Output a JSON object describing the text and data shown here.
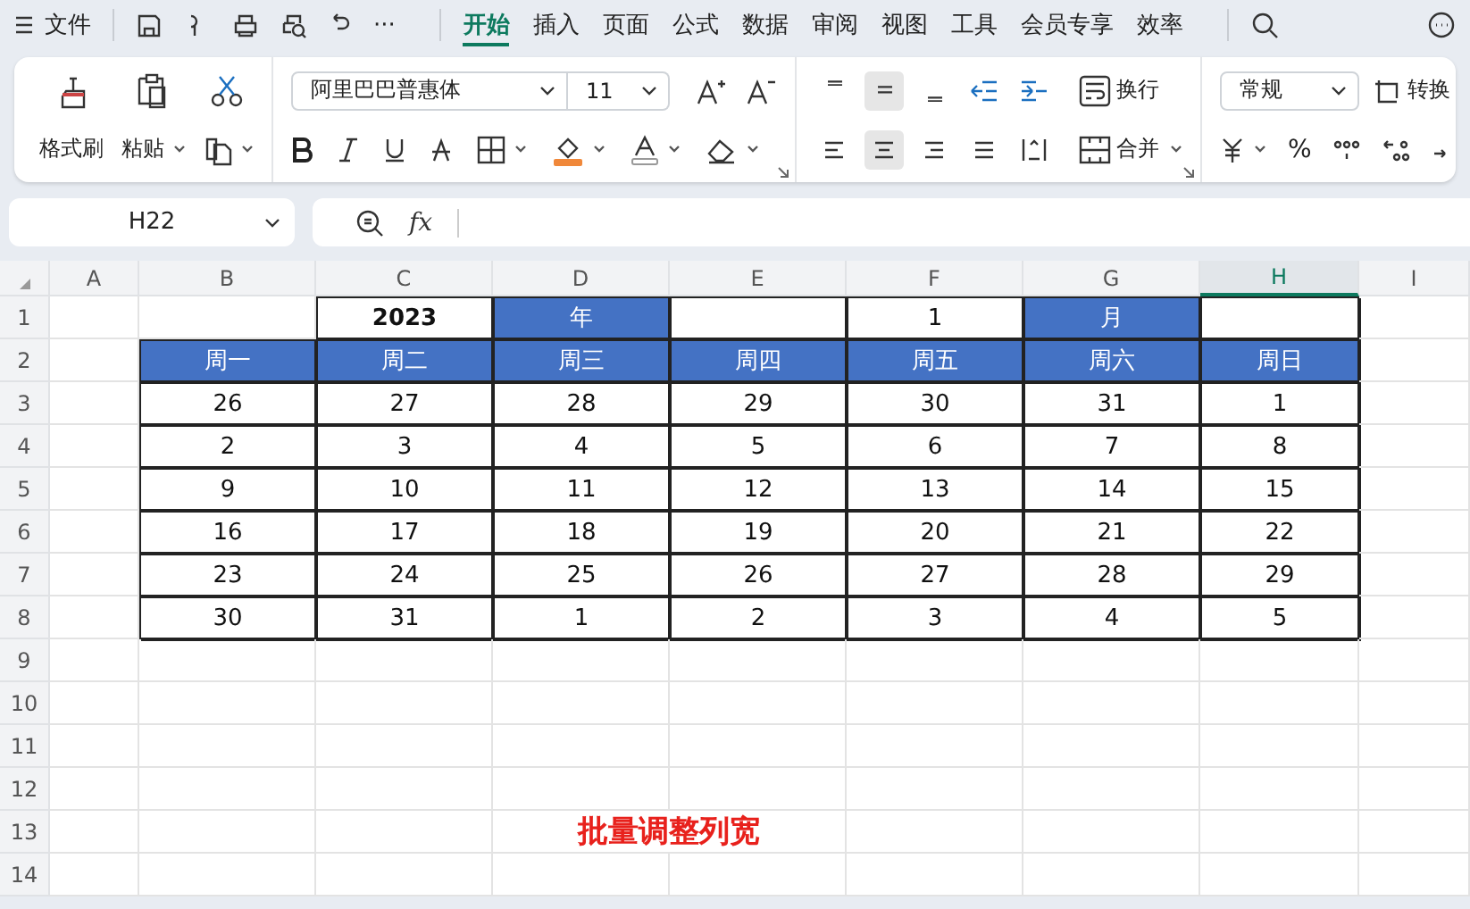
{
  "menu_bar": {
    "file_label": "文件",
    "overflow": "···",
    "tabs": [
      {
        "label": "开始",
        "selected": true
      },
      {
        "label": "插入",
        "selected": false
      },
      {
        "label": "页面",
        "selected": false
      },
      {
        "label": "公式",
        "selected": false
      },
      {
        "label": "数据",
        "selected": false
      },
      {
        "label": "审阅",
        "selected": false
      },
      {
        "label": "视图",
        "selected": false
      },
      {
        "label": "工具",
        "selected": false
      },
      {
        "label": "会员专享",
        "selected": false
      },
      {
        "label": "效率",
        "selected": false
      }
    ]
  },
  "ribbon": {
    "format_painter": "格式刷",
    "paste": "粘贴",
    "font_name": "阿里巴巴普惠体",
    "font_size": "11",
    "vertical_align": [
      {
        "selected": false
      },
      {
        "selected": true
      },
      {
        "selected": false
      }
    ],
    "horizontal_align": [
      {
        "selected": false
      },
      {
        "selected": true
      },
      {
        "selected": false
      },
      {
        "selected": false
      },
      {
        "selected": false
      }
    ],
    "wrap": "换行",
    "merge": "合并",
    "number_format": "常规",
    "convert": "转换",
    "percent": "%"
  },
  "formula_bar": {
    "name_box": "H22",
    "function_label": "fx"
  },
  "sheet": {
    "columns": [
      {
        "label": "A",
        "selected": false
      },
      {
        "label": "B",
        "selected": false
      },
      {
        "label": "C",
        "selected": false
      },
      {
        "label": "D",
        "selected": false
      },
      {
        "label": "E",
        "selected": false
      },
      {
        "label": "F",
        "selected": false
      },
      {
        "label": "G",
        "selected": false
      },
      {
        "label": "H",
        "selected": true
      },
      {
        "label": "I",
        "selected": false
      }
    ],
    "rows": [
      {
        "label": "1",
        "cells": [
          {
            "kind": "blank"
          },
          {
            "kind": "title",
            "text": "2023"
          },
          {
            "kind": "header",
            "text": "年"
          },
          {
            "kind": "value"
          },
          {
            "kind": "value",
            "text": "1"
          },
          {
            "kind": "header",
            "text": "月"
          },
          {
            "kind": "value"
          }
        ]
      },
      {
        "label": "2",
        "cells": [
          {
            "kind": "header",
            "text": "周一"
          },
          {
            "kind": "header",
            "text": "周二"
          },
          {
            "kind": "header",
            "text": "周三"
          },
          {
            "kind": "header",
            "text": "周四"
          },
          {
            "kind": "header",
            "text": "周五"
          },
          {
            "kind": "header",
            "text": "周六"
          },
          {
            "kind": "header",
            "text": "周日"
          }
        ]
      },
      {
        "label": "3",
        "cells": [
          {
            "kind": "value",
            "text": "26"
          },
          {
            "kind": "value",
            "text": "27"
          },
          {
            "kind": "value",
            "text": "28"
          },
          {
            "kind": "value",
            "text": "29"
          },
          {
            "kind": "value",
            "text": "30"
          },
          {
            "kind": "value",
            "text": "31"
          },
          {
            "kind": "value",
            "text": "1"
          }
        ]
      },
      {
        "label": "4",
        "cells": [
          {
            "kind": "value",
            "text": "2"
          },
          {
            "kind": "value",
            "text": "3"
          },
          {
            "kind": "value",
            "text": "4"
          },
          {
            "kind": "value",
            "text": "5"
          },
          {
            "kind": "value",
            "text": "6"
          },
          {
            "kind": "value",
            "text": "7"
          },
          {
            "kind": "value",
            "text": "8"
          }
        ]
      },
      {
        "label": "5",
        "cells": [
          {
            "kind": "value",
            "text": "9"
          },
          {
            "kind": "value",
            "text": "10"
          },
          {
            "kind": "value",
            "text": "11"
          },
          {
            "kind": "value",
            "text": "12"
          },
          {
            "kind": "value",
            "text": "13"
          },
          {
            "kind": "value",
            "text": "14"
          },
          {
            "kind": "value",
            "text": "15"
          }
        ]
      },
      {
        "label": "6",
        "cells": [
          {
            "kind": "value",
            "text": "16"
          },
          {
            "kind": "value",
            "text": "17"
          },
          {
            "kind": "value",
            "text": "18"
          },
          {
            "kind": "value",
            "text": "19"
          },
          {
            "kind": "value",
            "text": "20"
          },
          {
            "kind": "value",
            "text": "21"
          },
          {
            "kind": "value",
            "text": "22"
          }
        ]
      },
      {
        "label": "7",
        "cells": [
          {
            "kind": "value",
            "text": "23"
          },
          {
            "kind": "value",
            "text": "24"
          },
          {
            "kind": "value",
            "text": "25"
          },
          {
            "kind": "value",
            "text": "26"
          },
          {
            "kind": "value",
            "text": "27"
          },
          {
            "kind": "value",
            "text": "28"
          },
          {
            "kind": "value",
            "text": "29"
          }
        ]
      },
      {
        "label": "8",
        "cells": [
          {
            "kind": "value",
            "text": "30"
          },
          {
            "kind": "value",
            "text": "31"
          },
          {
            "kind": "value",
            "text": "1"
          },
          {
            "kind": "value",
            "text": "2"
          },
          {
            "kind": "value",
            "text": "3"
          },
          {
            "kind": "value",
            "text": "4"
          },
          {
            "kind": "value",
            "text": "5"
          }
        ]
      },
      {
        "label": "9"
      },
      {
        "label": "10"
      },
      {
        "label": "11"
      },
      {
        "label": "12"
      },
      {
        "label": "13"
      },
      {
        "label": "14"
      }
    ],
    "caption": "批量调整列宽"
  }
}
